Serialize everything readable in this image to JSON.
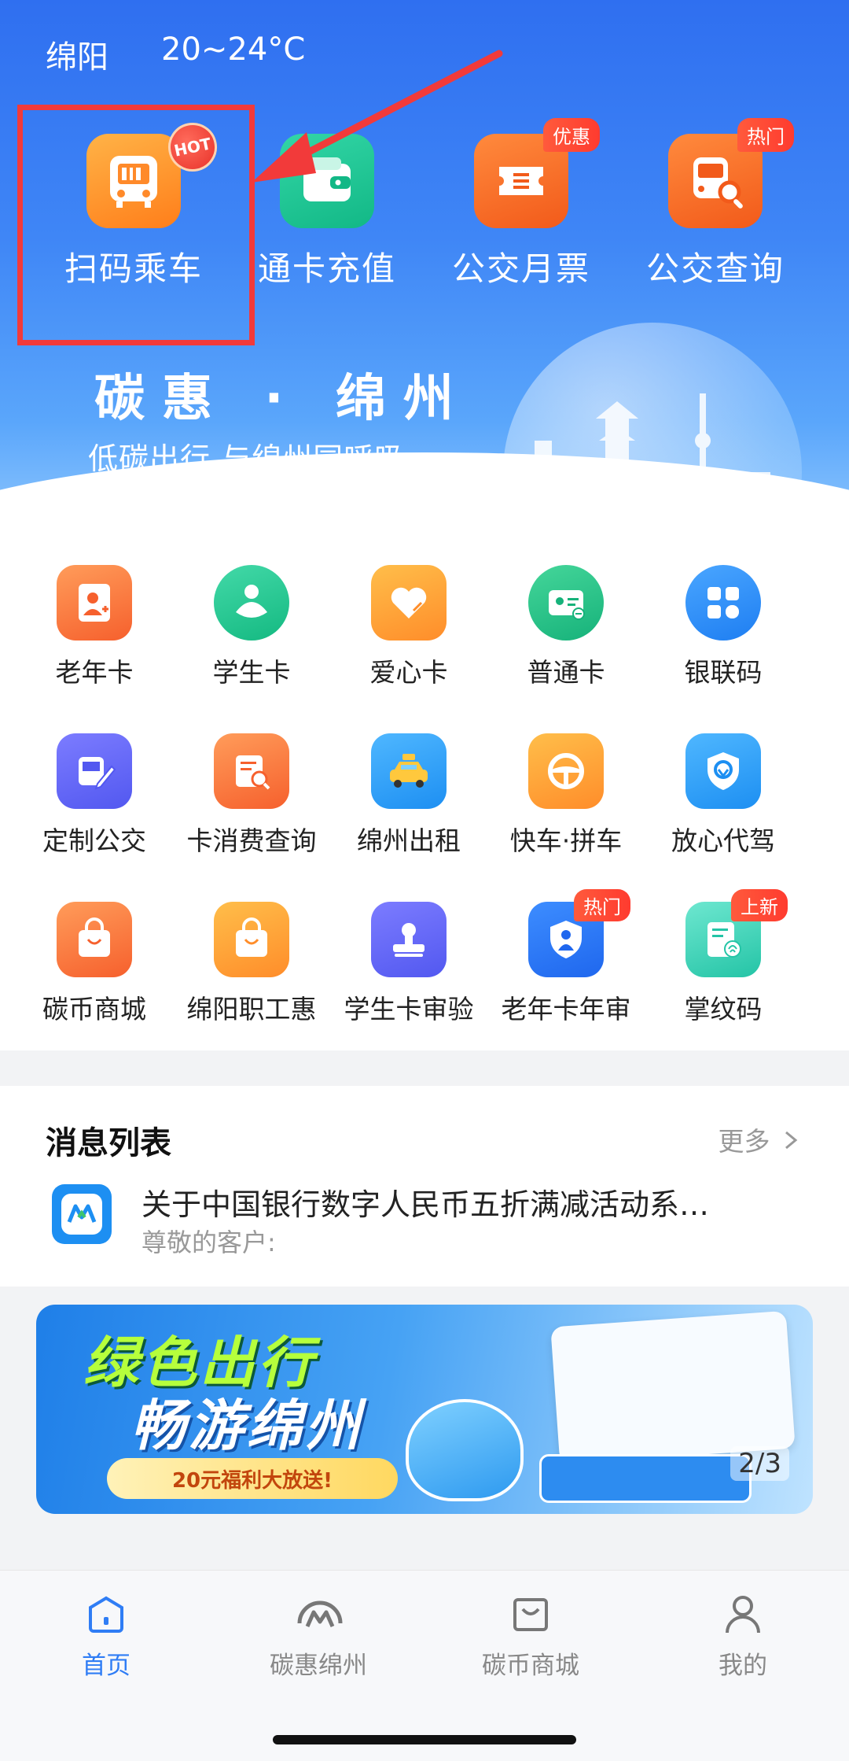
{
  "header": {
    "city": "绵阳",
    "temperature": "20~24°C",
    "slogan_title": "碳惠 · 绵州",
    "slogan_subtitle": "低碳出行,与绵州同呼吸"
  },
  "top_entries": [
    {
      "label": "扫码乘车",
      "icon": "qr-bus-icon",
      "badge": "HOT"
    },
    {
      "label": "通卡充值",
      "icon": "wallet-icon",
      "badge": ""
    },
    {
      "label": "公交月票",
      "icon": "ticket-icon",
      "badge": "优惠"
    },
    {
      "label": "公交查询",
      "icon": "bus-search-icon",
      "badge": "热门"
    }
  ],
  "services": [
    {
      "label": "老年卡",
      "icon": "elder-card-icon"
    },
    {
      "label": "学生卡",
      "icon": "student-card-icon"
    },
    {
      "label": "爱心卡",
      "icon": "heart-card-icon"
    },
    {
      "label": "普通卡",
      "icon": "normal-card-icon"
    },
    {
      "label": "银联码",
      "icon": "unionpay-code-icon"
    },
    {
      "label": "定制公交",
      "icon": "custom-bus-icon"
    },
    {
      "label": "卡消费查询",
      "icon": "card-spend-query-icon"
    },
    {
      "label": "绵州出租",
      "icon": "taxi-icon"
    },
    {
      "label": "快车·拼车",
      "icon": "steering-wheel-icon"
    },
    {
      "label": "放心代驾",
      "icon": "shield-driver-icon"
    },
    {
      "label": "碳币商城",
      "icon": "shopping-bag-icon"
    },
    {
      "label": "绵阳职工惠",
      "icon": "worker-bag-icon"
    },
    {
      "label": "学生卡审验",
      "icon": "stamp-icon"
    },
    {
      "label": "老年卡年审",
      "icon": "elder-review-icon",
      "badge": "热门"
    },
    {
      "label": "掌纹码",
      "icon": "palm-code-icon",
      "badge": "上新"
    }
  ],
  "messages": {
    "title": "消息列表",
    "more": "更多",
    "headline": "关于中国银行数字人民币五折满减活动系…",
    "subtitle": "尊敬的客户:"
  },
  "banner": {
    "line1": "绿色出行",
    "line2": "畅游绵州",
    "ribbon": "20元福利大放送!",
    "page_indicator": "2/3"
  },
  "tabbar": [
    {
      "label": "首页",
      "icon": "home-icon",
      "active": true
    },
    {
      "label": "碳惠绵州",
      "icon": "carbon-logo-icon",
      "active": false
    },
    {
      "label": "碳币商城",
      "icon": "shop-bag-icon",
      "active": false
    },
    {
      "label": "我的",
      "icon": "profile-icon",
      "active": false
    }
  ],
  "colors": {
    "header_blue": "#2f6ff0",
    "highlight_red": "#f23a3a",
    "active_tab": "#2f7df5",
    "badge_red": "#ff3b2f"
  }
}
